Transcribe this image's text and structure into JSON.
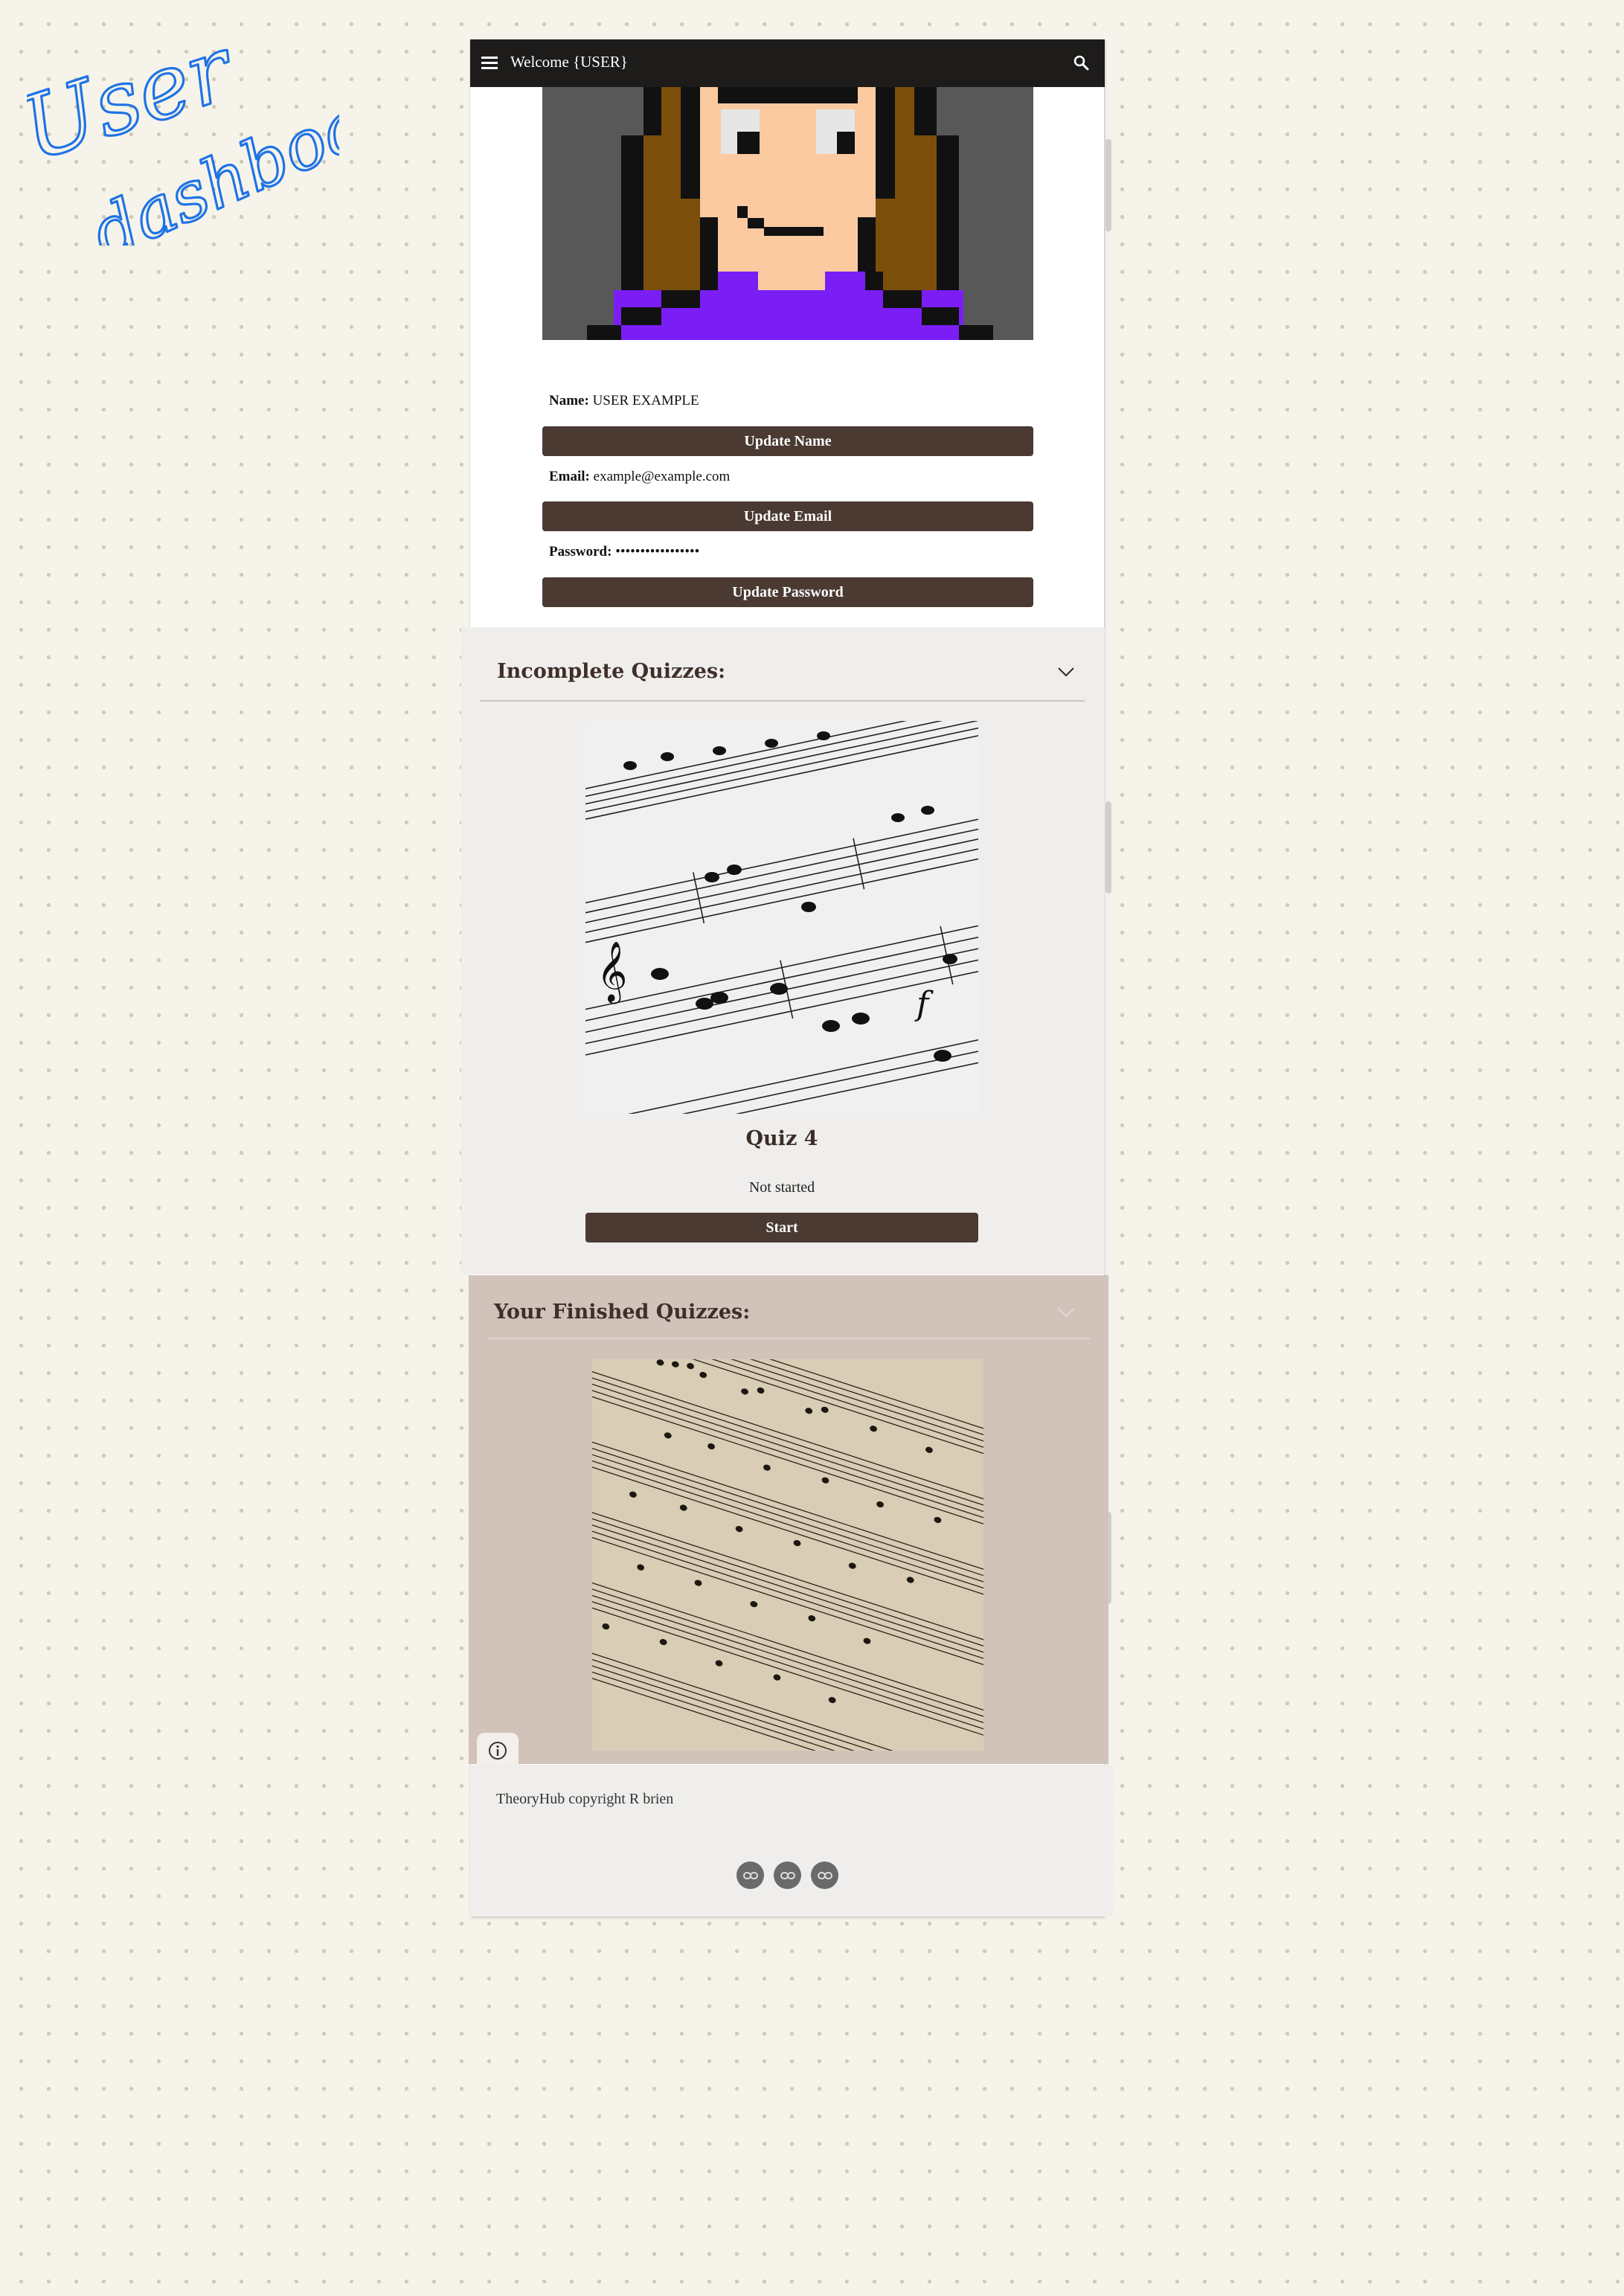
{
  "annotation": {
    "text_line1": "User",
    "text_line2": "dashboard"
  },
  "appbar": {
    "menu_icon": "hamburger-menu-icon",
    "title": "Welcome {USER}",
    "search_icon": "search-icon"
  },
  "profile": {
    "avatar_icon": "pixel-art-avatar",
    "name_label": "Name:",
    "name_value": "USER EXAMPLE",
    "update_name_label": "Update Name",
    "email_label": "Email:",
    "email_value": "example@example.com",
    "update_email_label": "Update Email",
    "password_label": "Password:",
    "password_value": "•••••••••••••••••",
    "update_password_label": "Update Password"
  },
  "incomplete": {
    "heading": "Incomplete Quizzes:",
    "expand_icon": "chevron-down-icon",
    "quiz": {
      "image": "sheet-music-photo",
      "title": "Quiz 4",
      "status": "Not started",
      "start_label": "Start"
    }
  },
  "finished": {
    "heading": "Your Finished Quizzes:",
    "expand_icon": "chevron-down-icon",
    "image": "sheet-music-photo-vintage"
  },
  "info_icon": "info-icon",
  "footer": {
    "copyright": "TheoryHub copyright R brien",
    "link_icons": [
      "link-icon",
      "link-icon",
      "link-icon"
    ]
  },
  "colors": {
    "appbar": "#1d1c1b",
    "button": "#4a3a32",
    "incomplete_bg": "#efeeec",
    "finished_bg": "#d1c3b9",
    "annotation": "#1f73e6"
  }
}
